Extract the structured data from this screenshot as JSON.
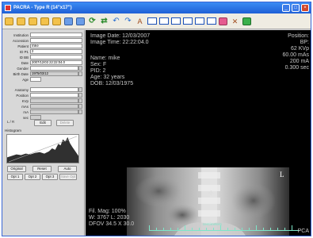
{
  "window": {
    "title": "PACRA - Type R (14\"x17\")",
    "btn_min": "_",
    "btn_max": "□",
    "btn_close": "×"
  },
  "toolbar": {
    "icons": [
      "folder-icon",
      "open-icon",
      "folder-icon",
      "image-icon",
      "open-icon",
      "layout-1-icon",
      "layout-2-icon",
      "layout-3-icon",
      "layout-4-icon",
      "layout-5-icon",
      "layout-6-icon",
      "heart-icon",
      "tools-icon",
      "export-icon"
    ]
  },
  "patient_form": {
    "labels": {
      "institution": "Institution",
      "accession": "Accession",
      "patient": "Patient",
      "id_p1": "ID P1",
      "id_bb": "ID BB",
      "date": "Date",
      "gender": "Gender",
      "birth_date": "Birth Date",
      "age": "Age"
    },
    "values": {
      "institution": "",
      "accession": "",
      "patient": "mike",
      "id_p1": "2",
      "id_bb": "",
      "date": "2007/12/03 22:22:04.0",
      "gender": "",
      "birth_date": "1975/03/12",
      "age": ""
    }
  },
  "exam_form": {
    "labels": {
      "anatomy": "Anatomy",
      "position": "Position",
      "kvp": "KVp",
      "mas": "mAs",
      "ma": "mA",
      "sec": "sec"
    },
    "values": {
      "anatomy": "",
      "position": "",
      "kvp": "",
      "mas": "",
      "ma": "",
      "sec": ""
    },
    "lr_label": "L / R",
    "edit_label": "Edit",
    "delete_label": "Delete"
  },
  "histogram": {
    "title": "Histogram",
    "original_label": "Original",
    "reset_label": "Reset",
    "auto_label": "Auto",
    "opt_labels": [
      "Opt 1",
      "Opt 2",
      "Opt 3",
      "Save Opt"
    ]
  },
  "overlay": {
    "image_date": "Image Date: 12/03/2007",
    "image_time": "Image Time: 22:22:04.0",
    "name": "Name: mike",
    "sex": "Sex: F",
    "pid": "PID: 2",
    "age": "Age: 32 years",
    "dob": "DOB: 12/03/1975",
    "position": "Position:",
    "bp": "BP:",
    "kv": "62 KVp",
    "mas": "60.00 mAs",
    "ma": "200 mA",
    "sec": "0.300 sec",
    "fil_mag": "Fil. Mag: 100%",
    "wl": "W: 3767 L: 2030",
    "dfov": "DFOV 34.5 X 30.0",
    "pca": "PCA",
    "ruler_label": "centimeters",
    "l_marker": "L"
  }
}
